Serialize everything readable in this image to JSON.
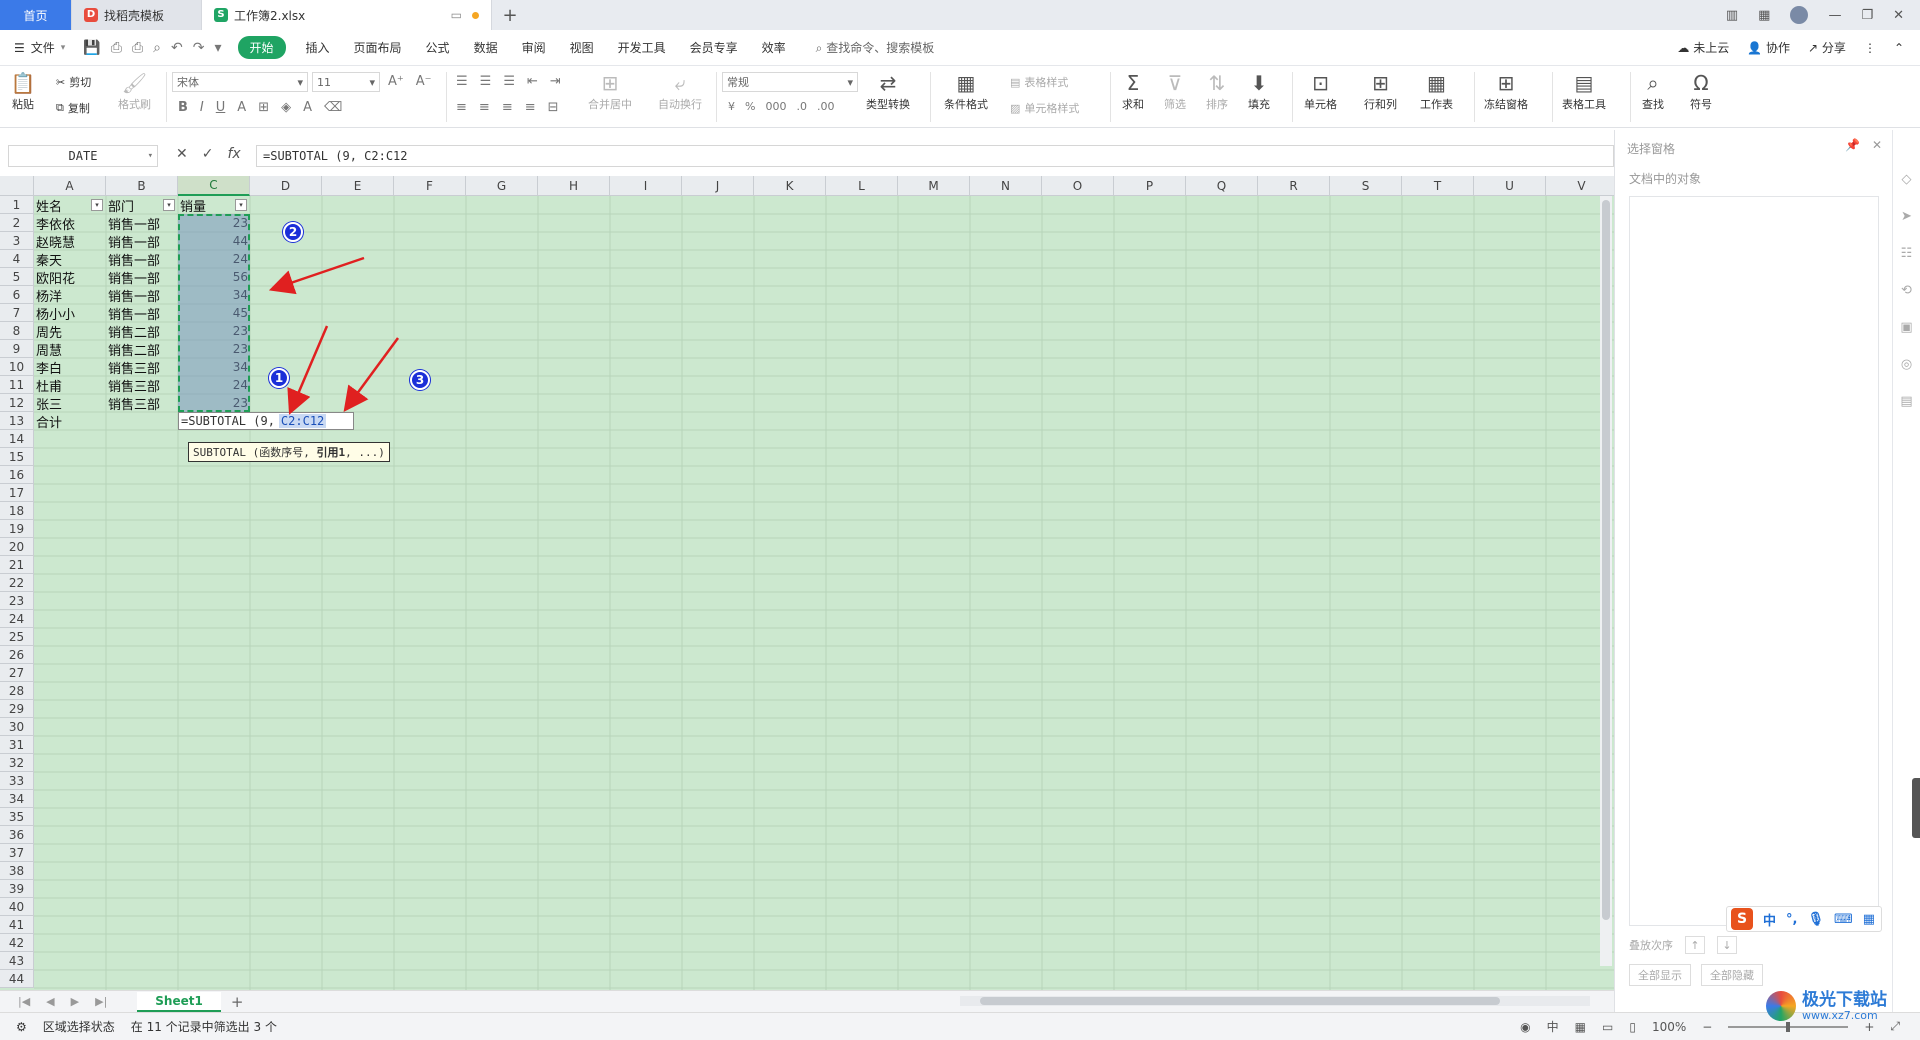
{
  "tabs": {
    "home": "首页",
    "template": "找稻壳模板",
    "file": "工作簿2.xlsx"
  },
  "menu": {
    "file": "文件",
    "items": [
      "开始",
      "插入",
      "页面布局",
      "公式",
      "数据",
      "审阅",
      "视图",
      "开发工具",
      "会员专享",
      "效率"
    ],
    "search": "查找命令、搜索模板",
    "cloud": "未上云",
    "collab": "协作",
    "share": "分享"
  },
  "ribbon": {
    "paste": "粘贴",
    "cut": "剪切",
    "copy": "复制",
    "format_painter": "格式刷",
    "font": "宋体",
    "size": "11",
    "number_format": "常规",
    "merge": "合并居中",
    "wrap": "自动换行",
    "type_convert": "类型转换",
    "cond_format": "条件格式",
    "table_style": "表格样式",
    "cell_style": "单元格样式",
    "sum": "求和",
    "filter": "筛选",
    "sort": "排序",
    "fill": "填充",
    "cell": "单元格",
    "rowcol": "行和列",
    "sheet": "工作表",
    "freeze": "冻结窗格",
    "table_tools": "表格工具",
    "find": "查找",
    "symbol": "符号"
  },
  "formula_bar": {
    "name_box": "DATE",
    "fx": "fx",
    "formula": "=SUBTOTAL (9, C2:C12"
  },
  "columns": [
    "A",
    "B",
    "C",
    "D",
    "E",
    "F",
    "G",
    "H",
    "I",
    "J",
    "K",
    "L",
    "M",
    "N",
    "O",
    "P",
    "Q",
    "R",
    "S",
    "T",
    "U",
    "V"
  ],
  "header_row": [
    "姓名",
    "部门",
    "销量"
  ],
  "rows": [
    [
      "李依依",
      "销售一部",
      "23"
    ],
    [
      "赵晓慧",
      "销售一部",
      "44"
    ],
    [
      "秦天",
      "销售一部",
      "24"
    ],
    [
      "欧阳花",
      "销售一部",
      "56"
    ],
    [
      "杨洋",
      "销售一部",
      "34"
    ],
    [
      "杨小小",
      "销售一部",
      "45"
    ],
    [
      "周先",
      "销售二部",
      "23"
    ],
    [
      "周慧",
      "销售二部",
      "23"
    ],
    [
      "李白",
      "销售三部",
      "34"
    ],
    [
      "杜甫",
      "销售三部",
      "24"
    ],
    [
      "张三",
      "销售三部",
      "23"
    ]
  ],
  "total_label": "合计",
  "edit_cell": {
    "prefix": "=SUBTOTAL (9,",
    "ref": "C2:C12"
  },
  "tooltip": {
    "fn": "SUBTOTAL (函数序号,",
    "bold": "引用1",
    "tail": ", ...)"
  },
  "badges": [
    "1",
    "2",
    "3"
  ],
  "sheetbar": {
    "sheet": "Sheet1"
  },
  "statusbar": {
    "mode": "区域选择状态",
    "filter_info": "在 11 个记录中筛选出 3 个",
    "zoom": "100%",
    "ime_mode": "中"
  },
  "right_pane": {
    "title": "选择窗格",
    "objects_label": "文档中的对象",
    "order_label": "叠放次序",
    "show_all": "全部显示",
    "hide_all": "全部隐藏"
  },
  "watermark": {
    "name": "极光下载站",
    "url": "www.xz7.com"
  },
  "colors": {
    "grid_bg": "#cce8cf",
    "accent": "#1fa463",
    "arrow": "#e02020",
    "badge": "#1b2fd8"
  }
}
